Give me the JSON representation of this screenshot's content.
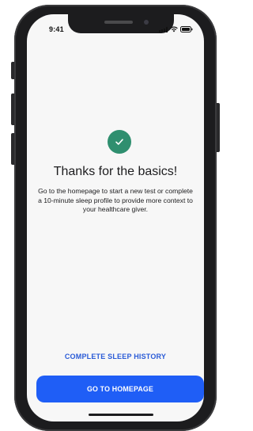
{
  "status_bar": {
    "time": "9:41"
  },
  "confirmation": {
    "icon": "check-circle-icon",
    "title": "Thanks for the basics!",
    "description": "Go to the homepage to start a new test or complete a 10-minute sleep profile to provide more context to your healthcare giver."
  },
  "actions": {
    "secondary_label": "COMPLETE SLEEP HISTORY",
    "primary_label": "GO TO HOMEPAGE"
  },
  "colors": {
    "accent": "#1f5ef6",
    "link": "#2a5bd7",
    "success": "#2f8f6f",
    "background": "#f7f7f7"
  }
}
